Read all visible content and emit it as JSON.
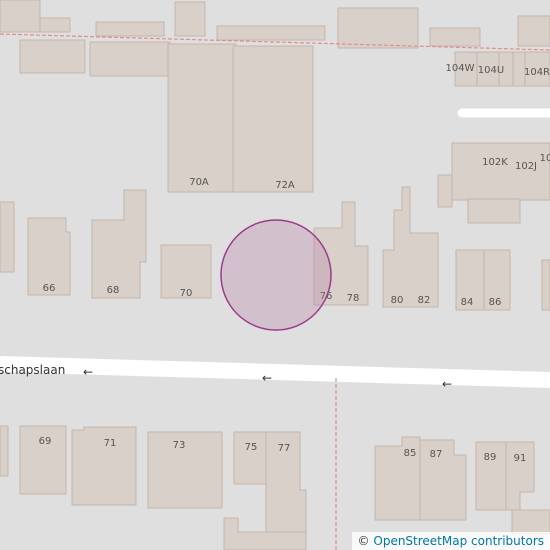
{
  "map": {
    "street_name": "schapslaan",
    "one_way_arrow": "←",
    "house_numbers": {
      "n66": "66",
      "n68": "68",
      "n70": "70",
      "n70A": "70A",
      "n72A": "72A",
      "n76": "76",
      "n78": "78",
      "n80": "80",
      "n82": "82",
      "n84": "84",
      "n86": "86",
      "n102K": "102K",
      "n102J": "102J",
      "n10x": "10",
      "n104W": "104W",
      "n104U": "104U",
      "n104R": "104R",
      "n69": "69",
      "n71": "71",
      "n73": "73",
      "n75": "75",
      "n77": "77",
      "n85": "85",
      "n87": "87",
      "n89": "89",
      "n91": "91"
    },
    "colors": {
      "land": "#e0dfdf",
      "building_fill": "#d9d0c9",
      "building_stroke": "#c4b6ab",
      "road": "#ffffff",
      "boundary": "#e08c8c",
      "marker_fill": "#c79ab8",
      "marker_stroke": "#9c3b8a"
    }
  },
  "attribution": {
    "symbol": "©",
    "link_text": "OpenStreetMap contributors"
  }
}
